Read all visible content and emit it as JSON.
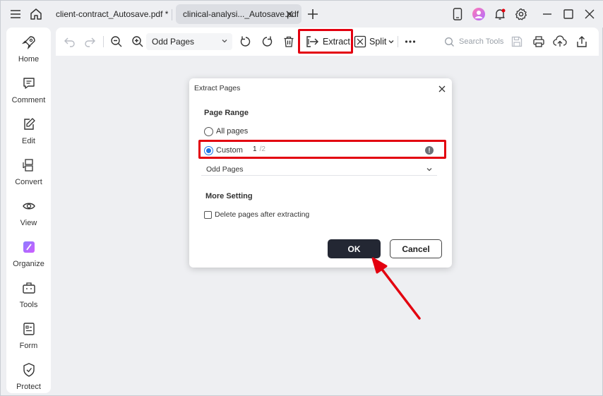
{
  "titlebar": {
    "tabs": [
      {
        "label": "client-contract_Autosave.pdf *",
        "active": false
      },
      {
        "label": "clinical-analysi..._Autosave.pdf",
        "active": true
      }
    ]
  },
  "sidebar": {
    "items": [
      {
        "label": "Home",
        "icon": "rocket-icon"
      },
      {
        "label": "Comment",
        "icon": "comment-icon"
      },
      {
        "label": "Edit",
        "icon": "edit-icon"
      },
      {
        "label": "Convert",
        "icon": "convert-icon"
      },
      {
        "label": "View",
        "icon": "eye-icon"
      },
      {
        "label": "Organize",
        "icon": "organize-icon"
      },
      {
        "label": "Tools",
        "icon": "toolbox-icon"
      },
      {
        "label": "Form",
        "icon": "form-icon"
      },
      {
        "label": "Protect",
        "icon": "shield-icon"
      }
    ]
  },
  "toolbar": {
    "page_select": "Odd Pages",
    "extract_label": "Extract",
    "split_label": "Split",
    "search_placeholder": "Search Tools"
  },
  "dialog": {
    "title": "Extract Pages",
    "page_range_title": "Page Range",
    "all_pages_label": "All pages",
    "custom_label": "Custom",
    "custom_value": "1",
    "custom_total": "/2",
    "subset_value": "Odd Pages",
    "more_setting_title": "More Setting",
    "delete_label": "Delete pages after extracting",
    "ok_label": "OK",
    "cancel_label": "Cancel"
  },
  "colors": {
    "highlight": "#e3000f",
    "ok_button": "#232733",
    "accent": "#1a73e8"
  }
}
